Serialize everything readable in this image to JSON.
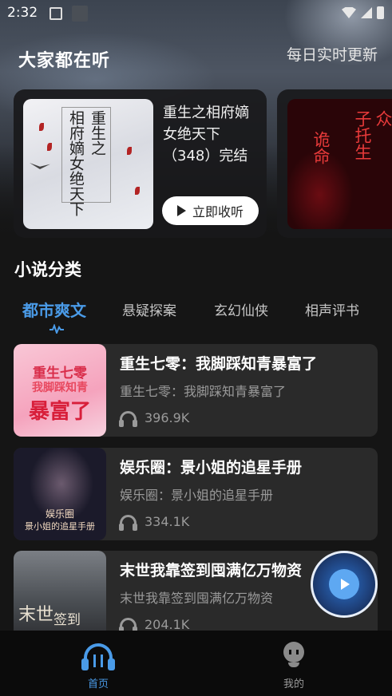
{
  "status_bar": {
    "time": "2:32"
  },
  "header": {
    "title": "大家都在听",
    "subtitle": "每日实时更新"
  },
  "featured": {
    "title": "重生之相府嫡女绝天下（348）完结",
    "cover_text_a": "重生之",
    "cover_text_b": "相府嫡女绝天下",
    "listen_label": "立即收听",
    "next_cover_text_a": "诡命",
    "next_cover_text_b": "众",
    "next_cover_text_c": "子托生"
  },
  "categories": {
    "title": "小说分类",
    "tabs": [
      {
        "label": "都市爽文",
        "active": true
      },
      {
        "label": "悬疑探案",
        "active": false
      },
      {
        "label": "玄幻仙侠",
        "active": false
      },
      {
        "label": "相声评书",
        "active": false
      }
    ]
  },
  "books": [
    {
      "title": "重生七零：我脚踩知青暴富了",
      "subtitle": "重生七零：我脚踩知青暴富了",
      "plays": "396.9K",
      "cover_lines": [
        "重生七零",
        "我脚踩知青",
        "暴富了"
      ]
    },
    {
      "title": "娱乐圈：景小姐的追星手册",
      "subtitle": "娱乐圈：景小姐的追星手册",
      "plays": "334.1K",
      "cover_lines": [
        "娱乐圈",
        "景小姐的追星手册"
      ]
    },
    {
      "title": "末世我靠签到囤满亿万物资",
      "subtitle": "末世我靠签到囤满亿万物资",
      "plays": "204.1K",
      "cover_lines": [
        "末世",
        "签到"
      ]
    }
  ],
  "bottom_nav": {
    "home": "首页",
    "mine": "我的"
  },
  "colors": {
    "accent": "#4a9be8",
    "card": "#2a2a2a",
    "background": "#151515"
  },
  "icons": [
    "wifi-icon",
    "signal-icon",
    "battery-icon",
    "play-icon",
    "headphone-icon",
    "home-icon",
    "mine-icon"
  ]
}
